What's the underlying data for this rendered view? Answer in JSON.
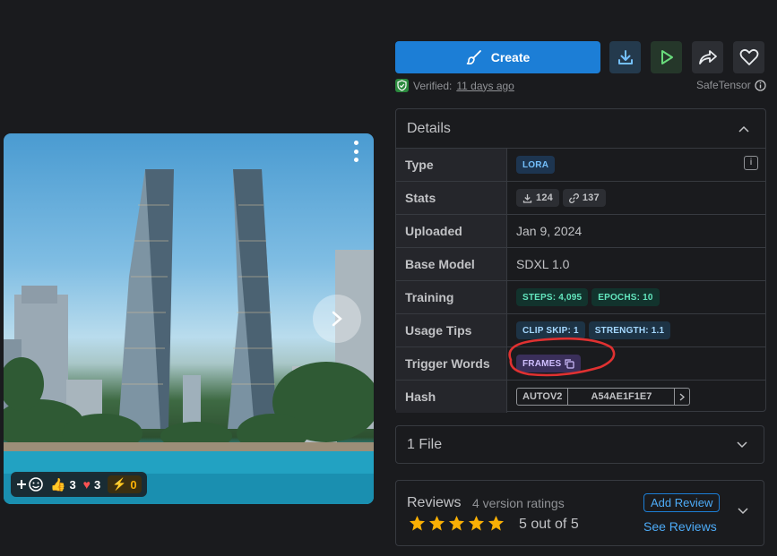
{
  "image_card": {
    "reactions": {
      "like_count": "3",
      "heart_count": "3",
      "buzz_count": "0"
    }
  },
  "actions": {
    "create_label": "Create",
    "verified_label": "Verified:",
    "verified_time": "11 days ago",
    "safetensor_label": "SafeTensor"
  },
  "details": {
    "title": "Details",
    "rows": {
      "type_key": "Type",
      "type_val": "LORA",
      "stats_key": "Stats",
      "stats_downloads": "124",
      "stats_links": "137",
      "uploaded_key": "Uploaded",
      "uploaded_val": "Jan 9, 2024",
      "base_key": "Base Model",
      "base_val": "SDXL 1.0",
      "training_key": "Training",
      "steps": "STEPS: 4,095",
      "epochs": "EPOCHS: 10",
      "usage_key": "Usage Tips",
      "clip_skip": "CLIP SKIP: 1",
      "strength": "STRENGTH: 1.1",
      "trigger_key": "Trigger Words",
      "trigger_val": "FRAMES",
      "hash_key": "Hash",
      "hash_type": "AUTOV2",
      "hash_val": "A54AE1F1E7"
    }
  },
  "files": {
    "label": "1 File"
  },
  "reviews": {
    "title": "Reviews",
    "count": "4 version ratings",
    "score": "5 out of 5",
    "add_review": "Add Review",
    "see_reviews": "See Reviews",
    "stars": 5
  },
  "colors": {
    "accent": "#1c7ed6",
    "star": "#fab005",
    "annotation": "#e03131",
    "verified": "#40c057"
  }
}
